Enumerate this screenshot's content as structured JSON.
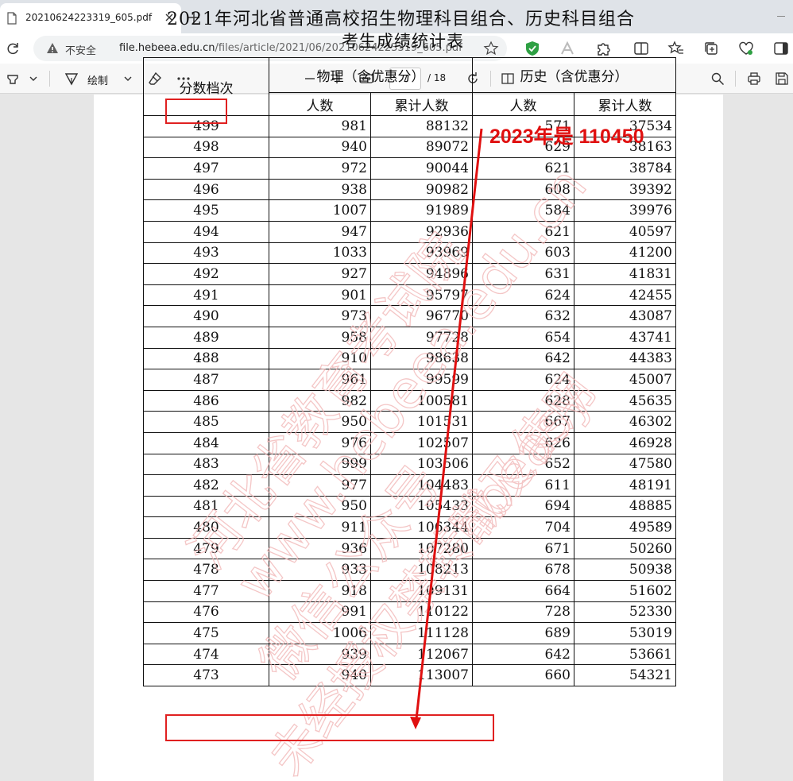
{
  "browser": {
    "tab_title": "20210624223319_605.pdf",
    "insecure_label": "不安全",
    "url_host": "file.hebeea.edu.cn",
    "url_path": "/files/article/2021/06/20210624223319_605.pdf"
  },
  "toolbar": {
    "draw_label": "绘制",
    "page_current": "7",
    "page_total": "/ 18"
  },
  "document": {
    "title_line1": "2021年河北省普通高校招生物理科目组合、历史科目组合",
    "title_line2": "考生成绩统计表",
    "watermark_lines": [
      "河北省教育考试院",
      "www.hebeea.edu.cn",
      "hbeasy",
      "微信公众号",
      "未经授权禁转载及使用"
    ]
  },
  "table": {
    "score_header": "分数档次",
    "physics_header": "物理（含优惠分）",
    "history_header": "历史（含优惠分）",
    "count_header": "人数",
    "cumulative_header": "累计人数",
    "rows": [
      [
        "499",
        "981",
        "88132",
        "571",
        "37534"
      ],
      [
        "498",
        "940",
        "89072",
        "629",
        "38163"
      ],
      [
        "497",
        "972",
        "90044",
        "621",
        "38784"
      ],
      [
        "496",
        "938",
        "90982",
        "608",
        "39392"
      ],
      [
        "495",
        "1007",
        "91989",
        "584",
        "39976"
      ],
      [
        "494",
        "947",
        "92936",
        "621",
        "40597"
      ],
      [
        "493",
        "1033",
        "93969",
        "603",
        "41200"
      ],
      [
        "492",
        "927",
        "94896",
        "631",
        "41831"
      ],
      [
        "491",
        "901",
        "95797",
        "624",
        "42455"
      ],
      [
        "490",
        "973",
        "96770",
        "632",
        "43087"
      ],
      [
        "489",
        "958",
        "97728",
        "654",
        "43741"
      ],
      [
        "488",
        "910",
        "98638",
        "642",
        "44383"
      ],
      [
        "487",
        "961",
        "99599",
        "624",
        "45007"
      ],
      [
        "486",
        "982",
        "100581",
        "628",
        "45635"
      ],
      [
        "485",
        "950",
        "101531",
        "667",
        "46302"
      ],
      [
        "484",
        "976",
        "102507",
        "626",
        "46928"
      ],
      [
        "483",
        "999",
        "103506",
        "652",
        "47580"
      ],
      [
        "482",
        "977",
        "104483",
        "611",
        "48191"
      ],
      [
        "481",
        "950",
        "105433",
        "694",
        "48885"
      ],
      [
        "480",
        "911",
        "106344",
        "704",
        "49589"
      ],
      [
        "479",
        "936",
        "107280",
        "671",
        "50260"
      ],
      [
        "478",
        "933",
        "108213",
        "678",
        "50938"
      ],
      [
        "477",
        "918",
        "109131",
        "664",
        "51602"
      ],
      [
        "476",
        "991",
        "110122",
        "728",
        "52330"
      ],
      [
        "475",
        "1006",
        "111128",
        "689",
        "53019"
      ],
      [
        "474",
        "939",
        "112067",
        "642",
        "53661"
      ],
      [
        "473",
        "940",
        "113007",
        "660",
        "54321"
      ]
    ]
  },
  "annotation": {
    "text": "2023年是 110450",
    "color": "#e01010"
  }
}
